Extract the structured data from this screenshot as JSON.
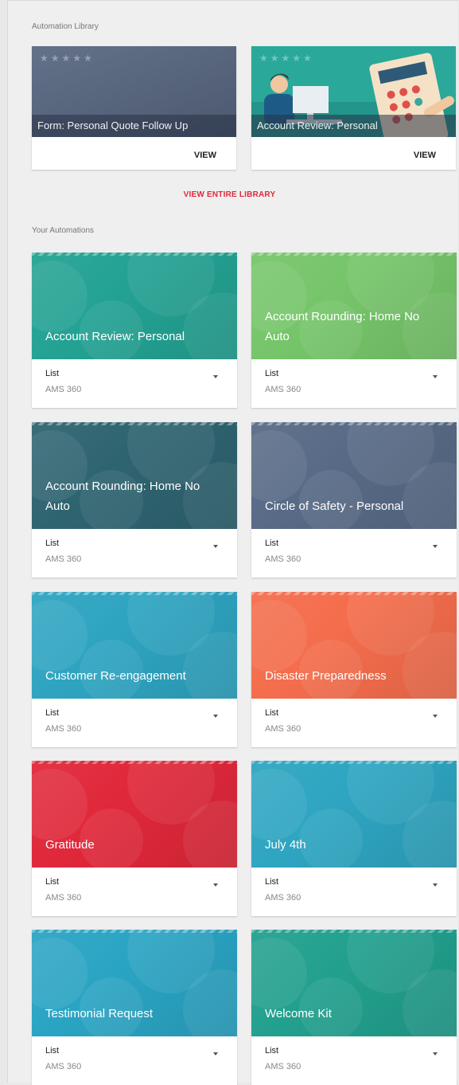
{
  "library": {
    "section_title": "Automation Library",
    "cards": [
      {
        "caption": "Form: Personal Quote Follow Up",
        "stars": "★★★★★",
        "view_label": "VIEW",
        "bg": "#56657f"
      },
      {
        "caption": "Account Review: Personal",
        "stars": "★★★★★",
        "view_label": "VIEW",
        "bg": "#2aa89a"
      }
    ],
    "view_all_label": "VIEW ENTIRE LIBRARY"
  },
  "automations": {
    "section_title": "Your Automations",
    "cards": [
      {
        "title": "Account Review: Personal",
        "type": "List",
        "source": "AMS 360",
        "color": "#23a293"
      },
      {
        "title": "Account Rounding: Home No Auto",
        "type": "List",
        "source": "AMS 360",
        "color": "#76c56a"
      },
      {
        "title": "Account Rounding: Home No Auto",
        "type": "List",
        "source": "AMS 360",
        "color": "#2e6470"
      },
      {
        "title": "Circle of Safety - Personal",
        "type": "List",
        "source": "AMS 360",
        "color": "#586a86"
      },
      {
        "title": "Customer Re-engagement",
        "type": "List",
        "source": "AMS 360",
        "color": "#2ea4c1"
      },
      {
        "title": "Disaster Preparedness",
        "type": "List",
        "source": "AMS 360",
        "color": "#f46d4c"
      },
      {
        "title": "Gratitude",
        "type": "List",
        "source": "AMS 360",
        "color": "#e0283a"
      },
      {
        "title": "July 4th",
        "type": "List",
        "source": "AMS 360",
        "color": "#2ea5c1"
      },
      {
        "title": "Testimonial Request",
        "type": "List",
        "source": "AMS 360",
        "color": "#2aa4c3"
      },
      {
        "title": "Welcome Kit",
        "type": "List",
        "source": "AMS 360",
        "color": "#22a08e"
      }
    ]
  }
}
